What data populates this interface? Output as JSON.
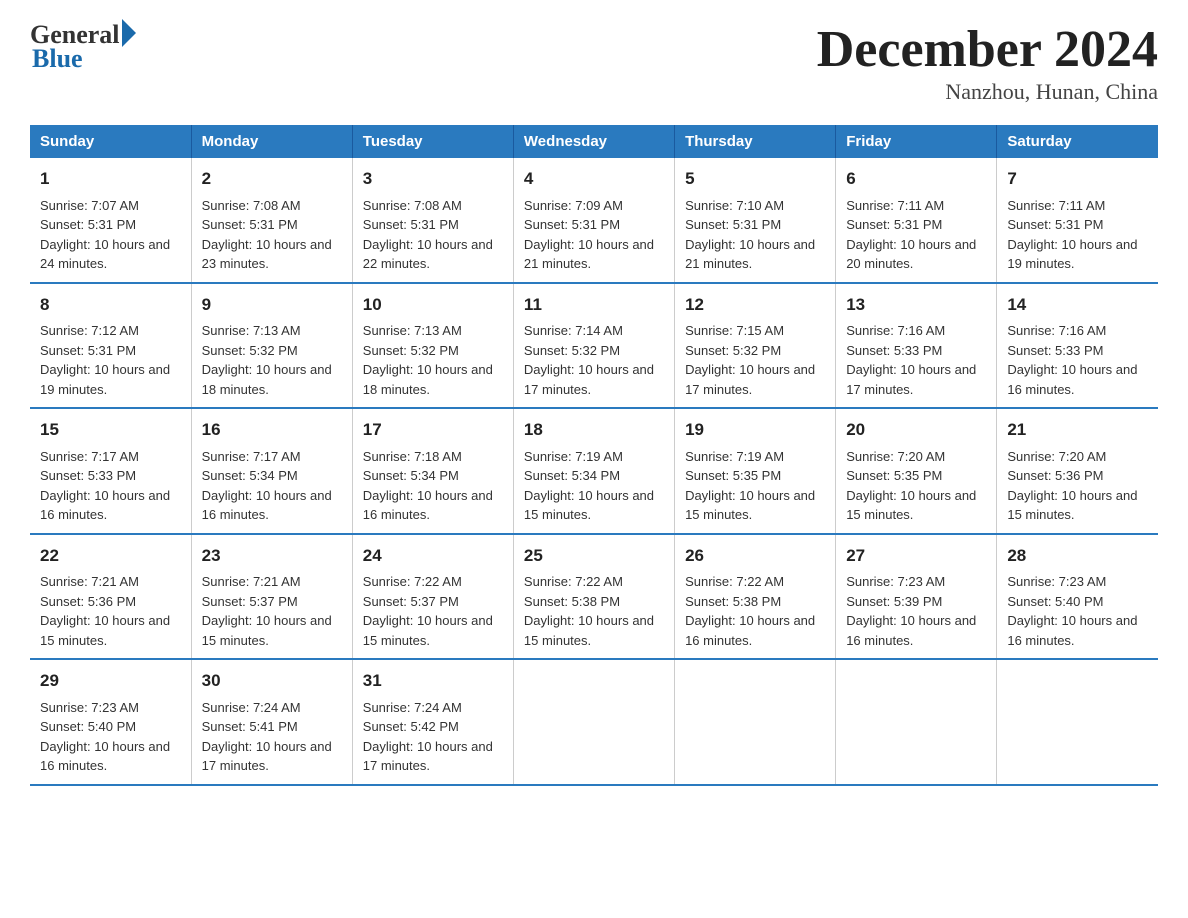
{
  "logo": {
    "general": "General",
    "blue": "Blue"
  },
  "title": "December 2024",
  "subtitle": "Nanzhou, Hunan, China",
  "headers": [
    "Sunday",
    "Monday",
    "Tuesday",
    "Wednesday",
    "Thursday",
    "Friday",
    "Saturday"
  ],
  "weeks": [
    [
      {
        "day": "1",
        "sunrise": "7:07 AM",
        "sunset": "5:31 PM",
        "daylight": "10 hours and 24 minutes."
      },
      {
        "day": "2",
        "sunrise": "7:08 AM",
        "sunset": "5:31 PM",
        "daylight": "10 hours and 23 minutes."
      },
      {
        "day": "3",
        "sunrise": "7:08 AM",
        "sunset": "5:31 PM",
        "daylight": "10 hours and 22 minutes."
      },
      {
        "day": "4",
        "sunrise": "7:09 AM",
        "sunset": "5:31 PM",
        "daylight": "10 hours and 21 minutes."
      },
      {
        "day": "5",
        "sunrise": "7:10 AM",
        "sunset": "5:31 PM",
        "daylight": "10 hours and 21 minutes."
      },
      {
        "day": "6",
        "sunrise": "7:11 AM",
        "sunset": "5:31 PM",
        "daylight": "10 hours and 20 minutes."
      },
      {
        "day": "7",
        "sunrise": "7:11 AM",
        "sunset": "5:31 PM",
        "daylight": "10 hours and 19 minutes."
      }
    ],
    [
      {
        "day": "8",
        "sunrise": "7:12 AM",
        "sunset": "5:31 PM",
        "daylight": "10 hours and 19 minutes."
      },
      {
        "day": "9",
        "sunrise": "7:13 AM",
        "sunset": "5:32 PM",
        "daylight": "10 hours and 18 minutes."
      },
      {
        "day": "10",
        "sunrise": "7:13 AM",
        "sunset": "5:32 PM",
        "daylight": "10 hours and 18 minutes."
      },
      {
        "day": "11",
        "sunrise": "7:14 AM",
        "sunset": "5:32 PM",
        "daylight": "10 hours and 17 minutes."
      },
      {
        "day": "12",
        "sunrise": "7:15 AM",
        "sunset": "5:32 PM",
        "daylight": "10 hours and 17 minutes."
      },
      {
        "day": "13",
        "sunrise": "7:16 AM",
        "sunset": "5:33 PM",
        "daylight": "10 hours and 17 minutes."
      },
      {
        "day": "14",
        "sunrise": "7:16 AM",
        "sunset": "5:33 PM",
        "daylight": "10 hours and 16 minutes."
      }
    ],
    [
      {
        "day": "15",
        "sunrise": "7:17 AM",
        "sunset": "5:33 PM",
        "daylight": "10 hours and 16 minutes."
      },
      {
        "day": "16",
        "sunrise": "7:17 AM",
        "sunset": "5:34 PM",
        "daylight": "10 hours and 16 minutes."
      },
      {
        "day": "17",
        "sunrise": "7:18 AM",
        "sunset": "5:34 PM",
        "daylight": "10 hours and 16 minutes."
      },
      {
        "day": "18",
        "sunrise": "7:19 AM",
        "sunset": "5:34 PM",
        "daylight": "10 hours and 15 minutes."
      },
      {
        "day": "19",
        "sunrise": "7:19 AM",
        "sunset": "5:35 PM",
        "daylight": "10 hours and 15 minutes."
      },
      {
        "day": "20",
        "sunrise": "7:20 AM",
        "sunset": "5:35 PM",
        "daylight": "10 hours and 15 minutes."
      },
      {
        "day": "21",
        "sunrise": "7:20 AM",
        "sunset": "5:36 PM",
        "daylight": "10 hours and 15 minutes."
      }
    ],
    [
      {
        "day": "22",
        "sunrise": "7:21 AM",
        "sunset": "5:36 PM",
        "daylight": "10 hours and 15 minutes."
      },
      {
        "day": "23",
        "sunrise": "7:21 AM",
        "sunset": "5:37 PM",
        "daylight": "10 hours and 15 minutes."
      },
      {
        "day": "24",
        "sunrise": "7:22 AM",
        "sunset": "5:37 PM",
        "daylight": "10 hours and 15 minutes."
      },
      {
        "day": "25",
        "sunrise": "7:22 AM",
        "sunset": "5:38 PM",
        "daylight": "10 hours and 15 minutes."
      },
      {
        "day": "26",
        "sunrise": "7:22 AM",
        "sunset": "5:38 PM",
        "daylight": "10 hours and 16 minutes."
      },
      {
        "day": "27",
        "sunrise": "7:23 AM",
        "sunset": "5:39 PM",
        "daylight": "10 hours and 16 minutes."
      },
      {
        "day": "28",
        "sunrise": "7:23 AM",
        "sunset": "5:40 PM",
        "daylight": "10 hours and 16 minutes."
      }
    ],
    [
      {
        "day": "29",
        "sunrise": "7:23 AM",
        "sunset": "5:40 PM",
        "daylight": "10 hours and 16 minutes."
      },
      {
        "day": "30",
        "sunrise": "7:24 AM",
        "sunset": "5:41 PM",
        "daylight": "10 hours and 17 minutes."
      },
      {
        "day": "31",
        "sunrise": "7:24 AM",
        "sunset": "5:42 PM",
        "daylight": "10 hours and 17 minutes."
      },
      null,
      null,
      null,
      null
    ]
  ]
}
